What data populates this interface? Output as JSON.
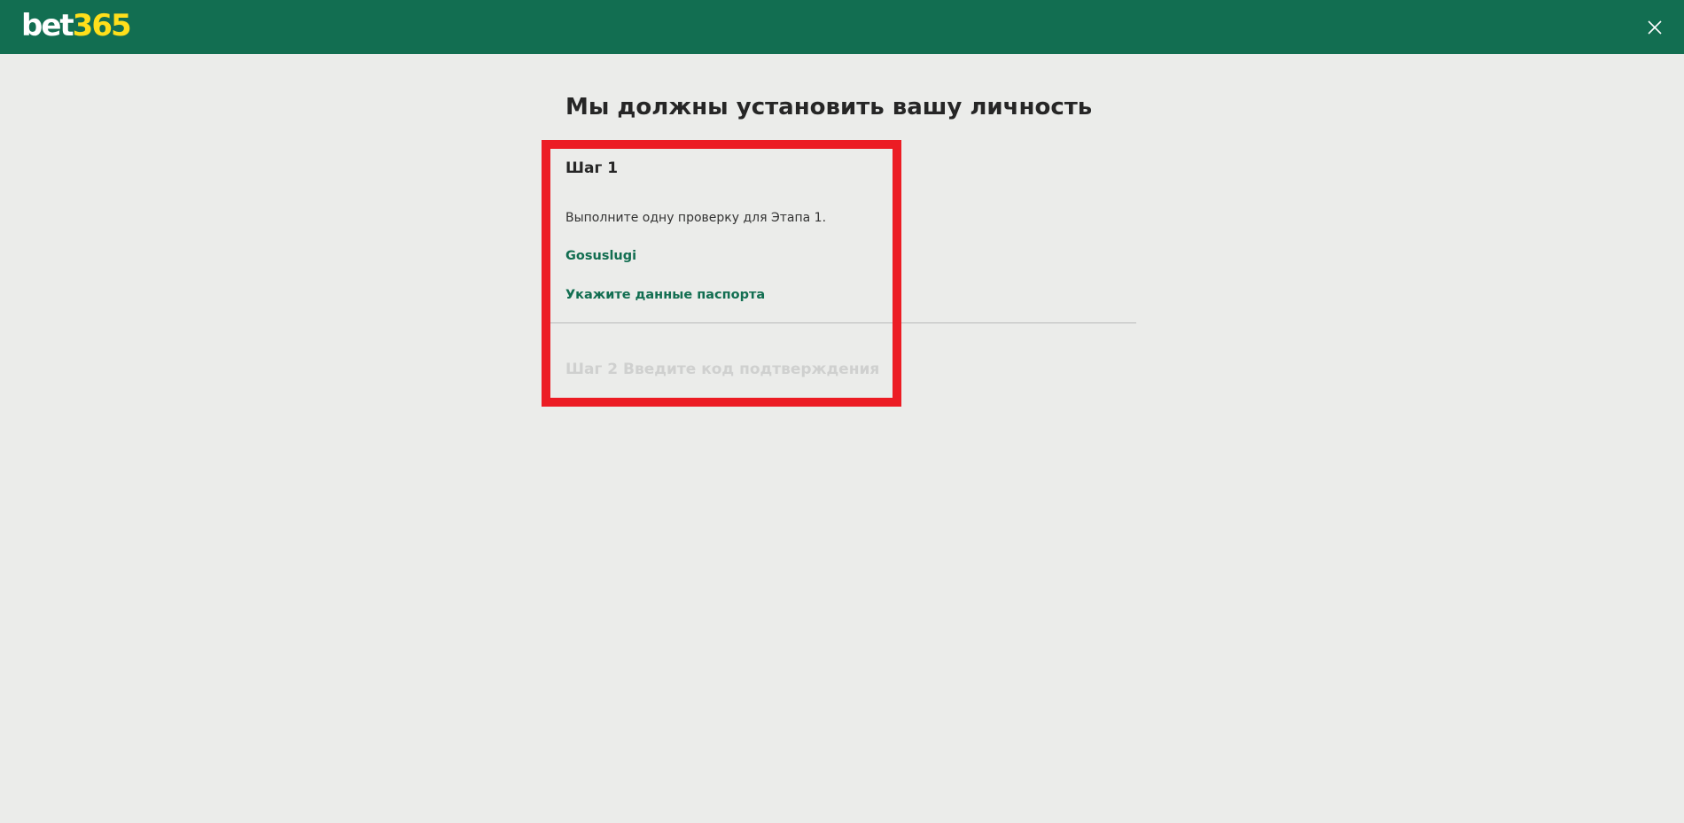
{
  "header": {
    "logo_part1": "bet",
    "logo_part2": "365",
    "close_icon": "close-icon",
    "colors": {
      "background": "#126e51",
      "logo_accent": "#ffdf1b"
    }
  },
  "main": {
    "title": "Мы должны установить вашу личность",
    "step1": {
      "title": "Шаг 1",
      "description": "Выполните одну проверку для Этапа 1.",
      "options": [
        {
          "label": "Gosuslugi"
        },
        {
          "label": "Укажите данные паспорта"
        }
      ]
    },
    "step2": {
      "title": "Шаг 2 Введите код подтверждения"
    }
  },
  "colors": {
    "page_background": "#ebecea",
    "link": "#126e51",
    "disabled_text": "#cfd0cf",
    "highlight": "#ec1c24"
  }
}
